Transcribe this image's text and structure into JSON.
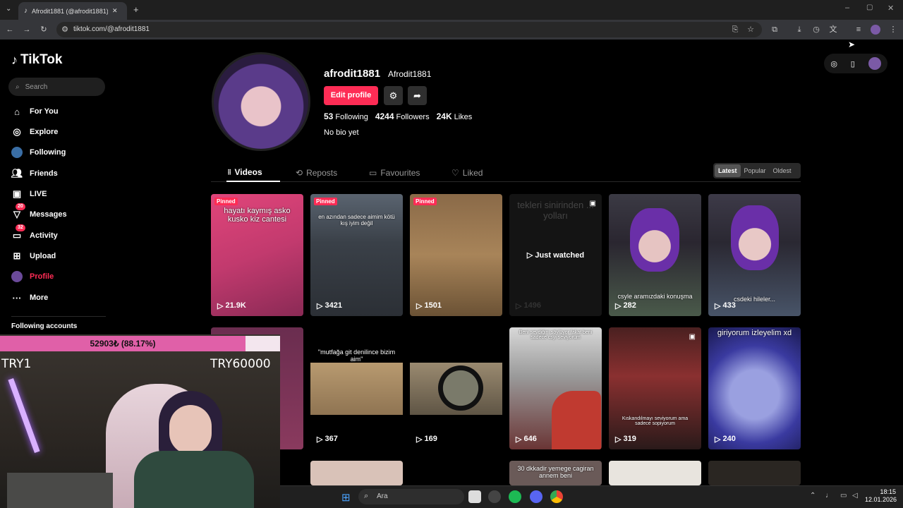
{
  "browser": {
    "tab_title": "Afrodit1881 (@afrodit1881) | TikTok",
    "url": "tiktok.com/@afrodit1881"
  },
  "sidebar": {
    "logo": "TikTok",
    "search_placeholder": "Search",
    "items": [
      {
        "label": "For You",
        "icon": "home-icon"
      },
      {
        "label": "Explore",
        "icon": "compass-icon"
      },
      {
        "label": "Following",
        "icon": "following-avatar-icon"
      },
      {
        "label": "Friends",
        "icon": "friends-icon"
      },
      {
        "label": "LIVE",
        "icon": "live-icon"
      },
      {
        "label": "Messages",
        "icon": "messages-icon",
        "badge": "20"
      },
      {
        "label": "Activity",
        "icon": "activity-icon",
        "badge": "32"
      },
      {
        "label": "Upload",
        "icon": "upload-icon"
      },
      {
        "label": "Profile",
        "icon": "profile-avatar-icon"
      },
      {
        "label": "More",
        "icon": "more-icon"
      }
    ],
    "following_accounts": "Following accounts"
  },
  "profile": {
    "username": "afrodit1881",
    "nickname": "Afrodit1881",
    "edit_label": "Edit profile",
    "following_count": "53",
    "following_label": "Following",
    "followers_count": "4244",
    "followers_label": "Followers",
    "likes_count": "24K",
    "likes_label": "Likes",
    "bio": "No bio yet"
  },
  "tabs": [
    "Videos",
    "Reposts",
    "Favourites",
    "Liked"
  ],
  "sort": [
    "Latest",
    "Popular",
    "Oldest"
  ],
  "videos": [
    {
      "views": "21.9K",
      "pinned": "Pinned",
      "caption": "hayatı kaymış asko kusko kiz cantesi"
    },
    {
      "views": "3421",
      "pinned": "Pinned",
      "caption": "en azından sadece aimim kötü kış iyim değil"
    },
    {
      "views": "1501",
      "pinned": "Pinned",
      "caption": ""
    },
    {
      "views": "1496",
      "overlay": "Just watched",
      "caption": "tekleri sinirinden ... yolları"
    },
    {
      "views": "282",
      "caption": "csyle aramızdaki konuşma"
    },
    {
      "views": "433",
      "caption": "csdeki hileler..."
    },
    {
      "views": "",
      "caption": ""
    },
    {
      "views": "367",
      "caption": "\"mutfağa git denilince bizim aim\""
    },
    {
      "views": "169",
      "caption": ""
    },
    {
      "views": "646",
      "caption": "Beni sevdiğini söylüyor fakat beni sadece csyi seviyorum"
    },
    {
      "views": "319",
      "caption": "Kıskandılmayı seviyorum ama sadece sopiyorum"
    },
    {
      "views": "240",
      "caption": "giriyorum izleyelim xd"
    }
  ],
  "row3_captions": [
    "30 dkkadir yemege cagiran annem beni"
  ],
  "overlay_stream": {
    "goal_text": "52903₺ (88.17%)",
    "goal_fraction": 0.8817,
    "left_label": "TRY1",
    "right_label": "TRY60000"
  },
  "taskbar": {
    "search": "Ara",
    "time": "18:15",
    "date": "12.01.2026"
  }
}
